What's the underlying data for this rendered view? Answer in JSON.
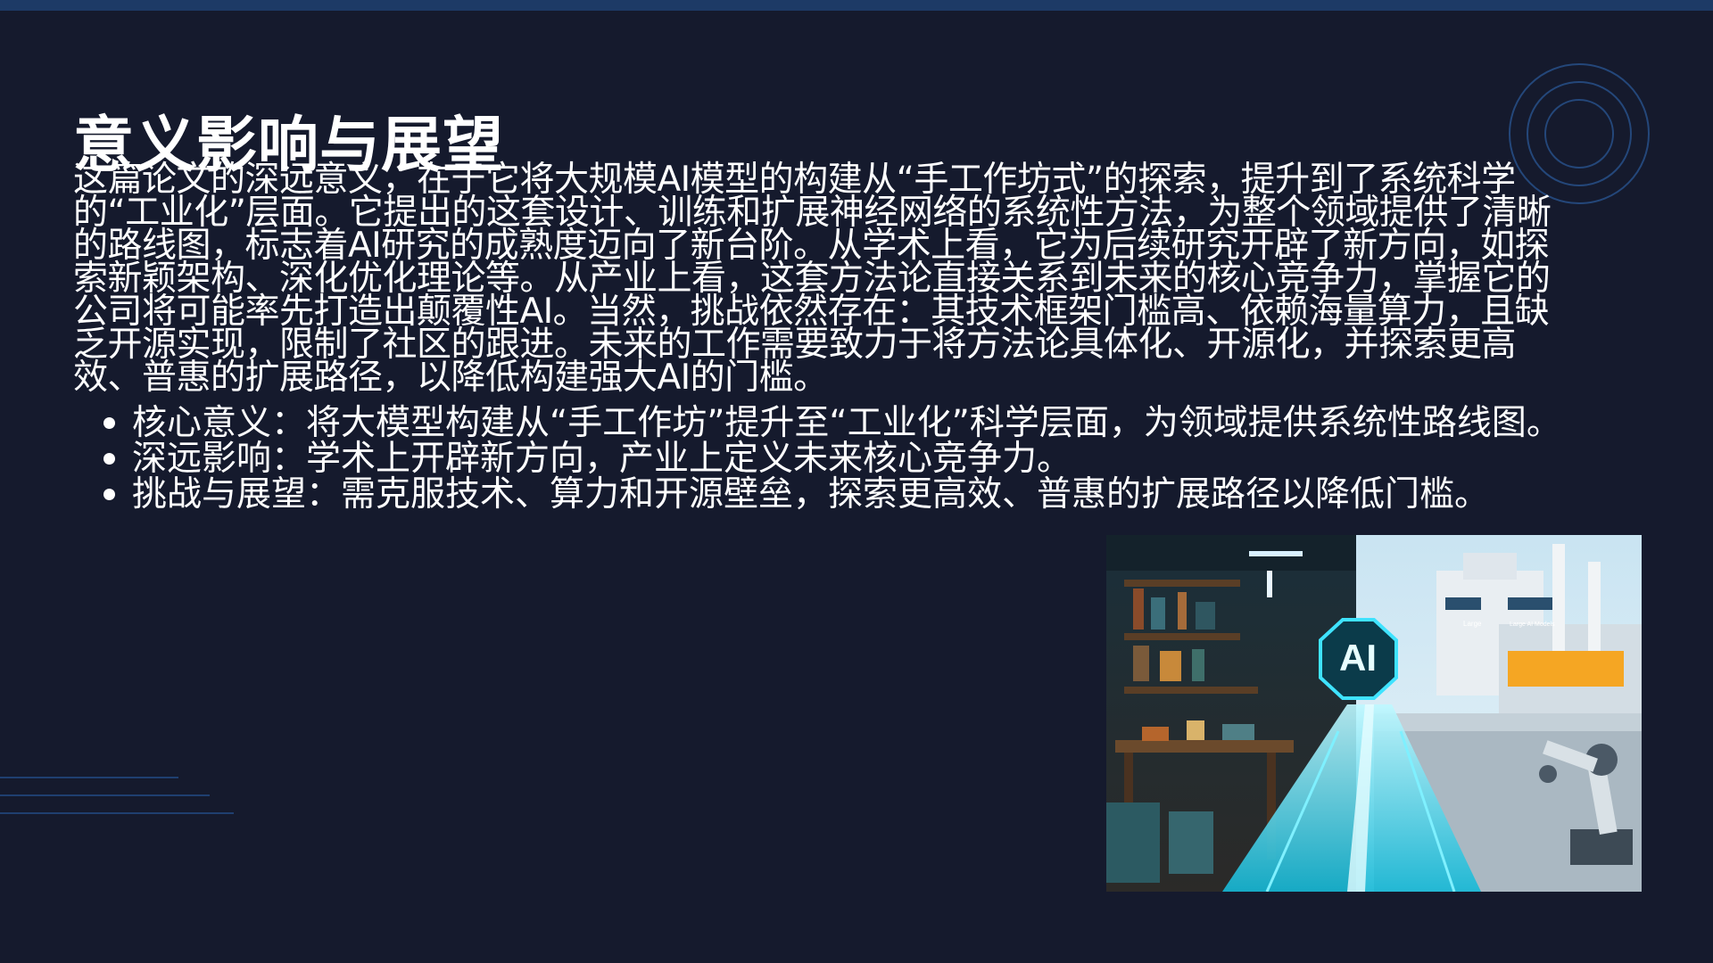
{
  "slide": {
    "title": "意义影响与展望",
    "paragraph": "这篇论文的深远意义，在于它将大规模AI模型的构建从“手工作坊式”的探索，提升到了系统科学的“工业化”层面。它提出的这套设计、训练和扩展神经网络的系统性方法，为整个领域提供了清晰的路线图，标志着AI研究的成熟度迈向了新台阶。从学术上看，它为后续研究开辟了新方向，如探索新颖架构、深化优化理论等。从产业上看，这套方法论直接关系到未来的核心竞争力，掌握它的公司将可能率先打造出颠覆性AI。当然，挑战依然存在：其技术框架门槛高、依赖海量算力，且缺乏开源实现，限制了社区的跟进。未来的工作需要致力于将方法论具体化、开源化，并探索更高效、普惠的扩展路径，以降低构建强大AI的门槛。",
    "bullets": [
      "核心意义：将大模型构建从“手工作坊”提升至“工业化”科学层面，为领域提供系统性路线图。",
      "深远影响：学术上开辟新方向，产业上定义未来核心竞争力。",
      "挑战与展望：需克服技术、算力和开源壁垒，探索更高效、普惠的扩展路径以降低门槛。"
    ]
  },
  "image": {
    "ai_label": "AI",
    "factory_sign_left": "Large",
    "factory_sign_right": "Large AI Models"
  },
  "colors": {
    "background": "#151a2d",
    "top_bar": "#1d3a66",
    "accent": "#2a6fb0",
    "glow": "#3fe3ff"
  }
}
